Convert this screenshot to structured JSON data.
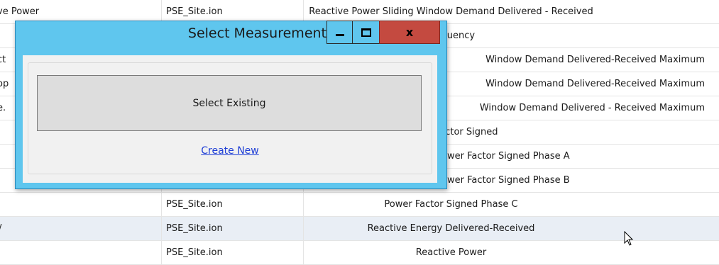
{
  "table": {
    "rows": [
      {
        "c1": "ve Power",
        "c2": "PSE_Site.ion",
        "c3": "Reactive Power Sliding Window Demand Delivered - Received"
      },
      {
        "c1": "",
        "c2": "",
        "c3": "Frequency"
      },
      {
        "c1": "ct",
        "c2": "",
        "c3": "Window Demand Delivered-Received Maximum"
      },
      {
        "c1": "op",
        "c2": "",
        "c3": "Window Demand Delivered-Received Maximum"
      },
      {
        "c1": "e.",
        "c2": "",
        "c3": "Window Demand Delivered - Received Maximum"
      },
      {
        "c1": "",
        "c2": "",
        "c3": "Power Factor Signed"
      },
      {
        "c1": "",
        "c2": "",
        "c3": "wer Factor Signed Phase A"
      },
      {
        "c1": "",
        "c2": "",
        "c3": "wer Factor Signed Phase B"
      },
      {
        "c1": "",
        "c2": "PSE_Site.ion",
        "c3": "Power Factor Signed Phase C"
      },
      {
        "c1": "/",
        "c2": "PSE_Site.ion",
        "c3": "Reactive Energy Delivered-Received"
      },
      {
        "c1": "",
        "c2": "PSE_Site.ion",
        "c3": "Reactive Power"
      }
    ]
  },
  "dialog": {
    "title": "Select Measurement",
    "close_label": "x",
    "select_existing_label": "Select Existing",
    "create_new_label": "Create New"
  },
  "colors": {
    "dialog_frame": "#5fc6ee",
    "close_button": "#c44a40",
    "link": "#1f3fd6",
    "selected_row": "#e9eef5"
  },
  "icons": {
    "minimize": "minimize-icon",
    "maximize": "maximize-icon",
    "close": "close-icon",
    "cursor": "mouse-pointer-icon"
  }
}
